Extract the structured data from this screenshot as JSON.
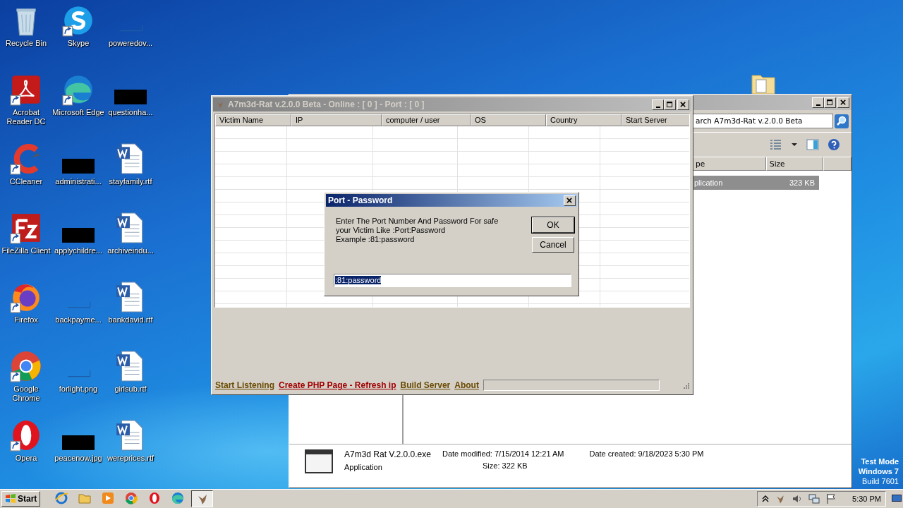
{
  "desktop_icons": [
    {
      "label": "Recycle Bin",
      "kind": "recycle",
      "shortcut": false
    },
    {
      "label": "Skype",
      "kind": "skype",
      "shortcut": true
    },
    {
      "label": "poweredov...",
      "kind": "blank",
      "shortcut": false
    },
    {
      "label": "Acrobat Reader DC",
      "kind": "acrobat",
      "shortcut": true
    },
    {
      "label": "Microsoft Edge",
      "kind": "edge",
      "shortcut": true
    },
    {
      "label": "questionha...",
      "kind": "redacted",
      "shortcut": false
    },
    {
      "label": "CCleaner",
      "kind": "ccleaner",
      "shortcut": true
    },
    {
      "label": "administrati...",
      "kind": "redacted",
      "shortcut": false
    },
    {
      "label": "stayfamily.rtf",
      "kind": "word",
      "shortcut": false
    },
    {
      "label": "FileZilla Client",
      "kind": "filezilla",
      "shortcut": true
    },
    {
      "label": "applychildre...",
      "kind": "redacted",
      "shortcut": false
    },
    {
      "label": "archiveindu...",
      "kind": "word",
      "shortcut": false
    },
    {
      "label": "Firefox",
      "kind": "firefox",
      "shortcut": true
    },
    {
      "label": "backpayme...",
      "kind": "blank",
      "shortcut": false
    },
    {
      "label": "bankdavid.rtf",
      "kind": "word",
      "shortcut": false
    },
    {
      "label": "Google Chrome",
      "kind": "chrome",
      "shortcut": true
    },
    {
      "label": "forlight.png",
      "kind": "blank",
      "shortcut": false
    },
    {
      "label": "girlsub.rtf",
      "kind": "word",
      "shortcut": false
    },
    {
      "label": "Opera",
      "kind": "opera",
      "shortcut": true
    },
    {
      "label": "peacenow.jpg",
      "kind": "redacted",
      "shortcut": false
    },
    {
      "label": "wereprices.rtf",
      "kind": "word",
      "shortcut": false
    }
  ],
  "explorer": {
    "search": "arch A7m3d-Rat v.2.0.0 Beta",
    "columns": [
      "pe",
      "Size"
    ],
    "row": {
      "type": "plication",
      "size": "323 KB",
      "selected": true
    },
    "details": {
      "name": "A7m3d Rat V.2.0.0.exe",
      "type": "Application",
      "modified_label": "Date modified:",
      "modified": "7/15/2014 12:21 AM",
      "created_label": "Date created:",
      "created": "9/18/2023 5:30 PM",
      "size_label": "Size:",
      "size": "322 KB"
    }
  },
  "rat_window": {
    "title": "A7m3d-Rat v.2.0.0 Beta - Online : [ 0 ] - Port : [ 0 ]",
    "columns": [
      "Victim Name",
      "IP",
      "computer / user",
      "OS",
      "Country",
      "Start Server"
    ],
    "links": [
      {
        "label": "Start Listening",
        "color": "#6b4a00"
      },
      {
        "label": "Create PHP Page - Refresh ip",
        "color": "#a00000"
      },
      {
        "label": "Build Server",
        "color": "#6b4a00"
      },
      {
        "label": "About",
        "color": "#6b4a00"
      }
    ]
  },
  "dialog": {
    "title": "Port - Password",
    "message": [
      "Enter The Port Number And Password For safe",
      "your Victim Like :Port:Password",
      "Example :81:password"
    ],
    "ok": "OK",
    "cancel": "Cancel",
    "input": {
      "value": ":81:password",
      "selected": true
    }
  },
  "test_mode": [
    "Test Mode",
    "Windows 7",
    "Build 7601"
  ],
  "taskbar": {
    "start": "Start",
    "items": [
      {
        "kind": "ie",
        "selected": false
      },
      {
        "kind": "folder",
        "selected": false
      },
      {
        "kind": "media",
        "selected": false
      },
      {
        "kind": "chrome",
        "selected": false
      },
      {
        "kind": "opera",
        "selected": false
      },
      {
        "kind": "edge",
        "selected": false
      },
      {
        "kind": "rat",
        "selected": true
      }
    ],
    "clock": "5:30 PM"
  }
}
